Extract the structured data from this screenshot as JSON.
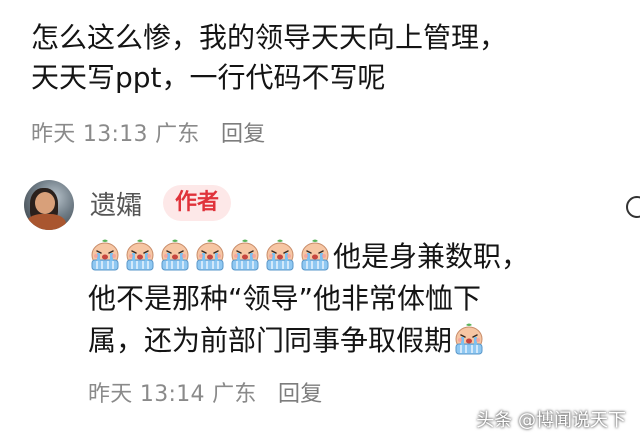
{
  "comment": {
    "text_line1": "怎么这么惨，我的领导天天向上管理，",
    "text_line2": "天天写ppt，一行代码不写呢",
    "time": "昨天 13:13",
    "location": "广东",
    "reply_label": "回复"
  },
  "reply": {
    "username": "遗孀",
    "badge": "作者",
    "emoji_name": "crying-face-emoji",
    "emoji_count": 7,
    "text_line1": "他是身兼数职，",
    "text_line2": "他不是那种“领导”他非常体恤下",
    "text_line3": "属，还为前部门同事争取假期",
    "time": "昨天 13:14",
    "location": "广东",
    "reply_label": "回复"
  },
  "watermark": "头条 @博闻说天下",
  "colors": {
    "badge_bg": "#fde8e8",
    "badge_text": "#e0323a",
    "meta_text": "#8a8a8a"
  }
}
